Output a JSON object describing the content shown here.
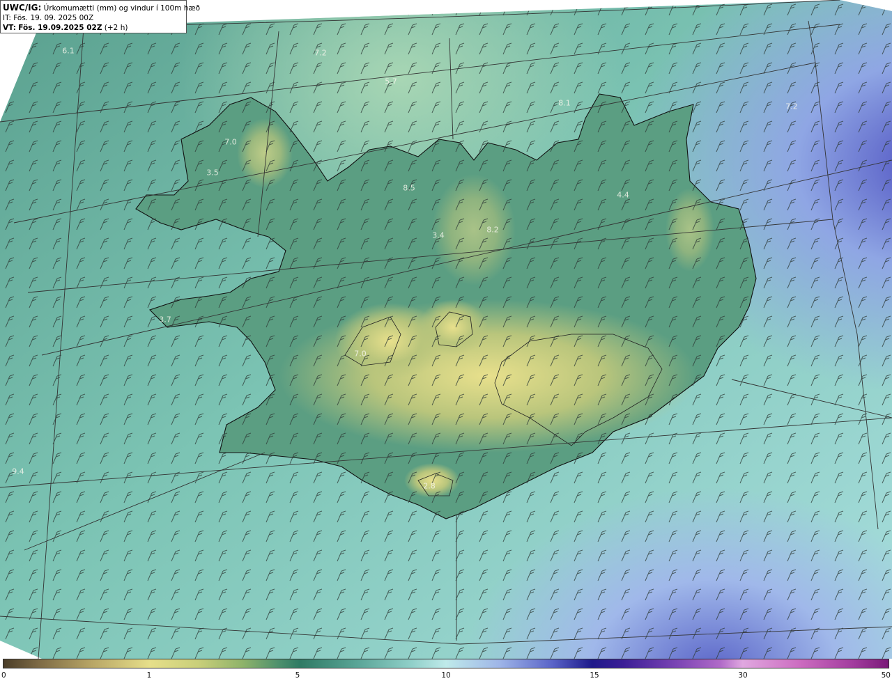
{
  "header": {
    "model": "UWC/IG:",
    "title": "Úrkomumætti (mm) og vindur í 100m hæð",
    "it_line": "IT: Fös. 19. 09. 2025 00Z",
    "vt_label": "VT:",
    "vt_value": "Fös. 19.09.2025 02Z",
    "vt_offset": "(+2 h)"
  },
  "point_values": [
    {
      "text": "6.1"
    },
    {
      "text": "7.2"
    },
    {
      "text": "5.7"
    },
    {
      "text": "8.1"
    },
    {
      "text": "7.2"
    },
    {
      "text": "7.0"
    },
    {
      "text": "3.5"
    },
    {
      "text": "8.5"
    },
    {
      "text": "4.4"
    },
    {
      "text": "3.4"
    },
    {
      "text": "8.2"
    },
    {
      "text": "3.7"
    },
    {
      "text": "7.0"
    },
    {
      "text": "9.4"
    },
    {
      "text": "2.8"
    }
  ],
  "colorbar": {
    "ticks": [
      "0",
      "1",
      "5",
      "10",
      "15",
      "30",
      "50"
    ]
  },
  "colors": {
    "sea_field": "#7cc4b4",
    "low_field": "#4f9a84",
    "high_field": "#d9d68a",
    "wet_field": "#5a64c8",
    "coastline": "#111111",
    "grid": "#333333"
  }
}
